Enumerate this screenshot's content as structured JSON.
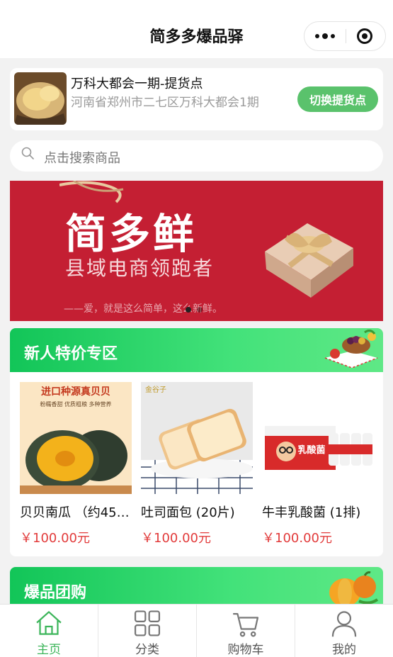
{
  "app": {
    "title": "简多多爆品驿"
  },
  "pickup": {
    "name": "万科大都会一期-提货点",
    "address": "河南省郑州市二七区万科大都会1期",
    "switch_label": "切换提货点"
  },
  "search": {
    "placeholder": "点击搜索商品"
  },
  "banner": {
    "headline": "简多鲜",
    "subline": "县域电商领跑者",
    "slogan": "——爱，就是这么简单，这么新鲜。",
    "slides": 2,
    "active_slide": 0
  },
  "sections": [
    {
      "title": "新人特价专区",
      "products": [
        {
          "name": "贝贝南瓜 （约45…",
          "price": "￥100.00元",
          "image_text": "进口种源真贝贝",
          "image_sub": "粉糯香甜 优质粗粮 多种营养"
        },
        {
          "name": "吐司面包 (20片)",
          "price": "￥100.00元",
          "image_text": "金谷子"
        },
        {
          "name": "牛丰乳酸菌 (1排)",
          "price": "￥100.00元",
          "image_text": "乳酸菌"
        }
      ]
    },
    {
      "title": "爆品团购"
    }
  ],
  "tabbar": {
    "items": [
      {
        "label": "主页",
        "icon": "home-icon",
        "active": true
      },
      {
        "label": "分类",
        "icon": "grid-icon",
        "active": false
      },
      {
        "label": "购物车",
        "icon": "cart-icon",
        "active": false
      },
      {
        "label": "我的",
        "icon": "user-icon",
        "active": false
      }
    ]
  },
  "colors": {
    "accent_green": "#3cb55a",
    "banner_red": "#c41f33",
    "price_red": "#e23b3b"
  }
}
